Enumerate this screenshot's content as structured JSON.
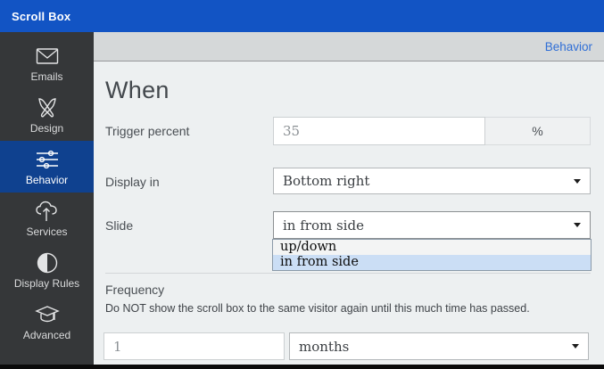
{
  "app": {
    "title": "Scroll Box"
  },
  "colors": {
    "topbar": "#1254c4",
    "sidebar_bg": "#353739",
    "sidebar_active": "#0f418f",
    "header_strip": "#d5d8d9",
    "breadcrumb_text": "#2f6ed6",
    "content_bg": "#edf0f1",
    "dropdown_highlight": "#cbdef5"
  },
  "sidebar": {
    "items": [
      {
        "label": "Emails",
        "icon": "envelope-icon",
        "active": false
      },
      {
        "label": "Design",
        "icon": "paintbrushes-icon",
        "active": false
      },
      {
        "label": "Behavior",
        "icon": "sliders-icon",
        "active": true
      },
      {
        "label": "Services",
        "icon": "cloud-upload-icon",
        "active": false
      },
      {
        "label": "Display Rules",
        "icon": "contrast-icon",
        "active": false
      },
      {
        "label": "Advanced",
        "icon": "graduation-cap-icon",
        "active": false
      }
    ]
  },
  "header": {
    "breadcrumb": "Behavior"
  },
  "when": {
    "heading": "When",
    "trigger_label": "Trigger percent",
    "trigger_value": "35",
    "trigger_unit": "%",
    "display_label": "Display in",
    "display_value": "Bottom right",
    "slide_label": "Slide",
    "slide_value": "in from side",
    "slide_options": {
      "0": "up/down",
      "1": "in from side"
    },
    "slide_highlighted": "in from side"
  },
  "frequency": {
    "label": "Frequency",
    "description": "Do NOT show the scroll box to the same visitor again until this much time has passed.",
    "value": "1",
    "unit_value": "months"
  }
}
